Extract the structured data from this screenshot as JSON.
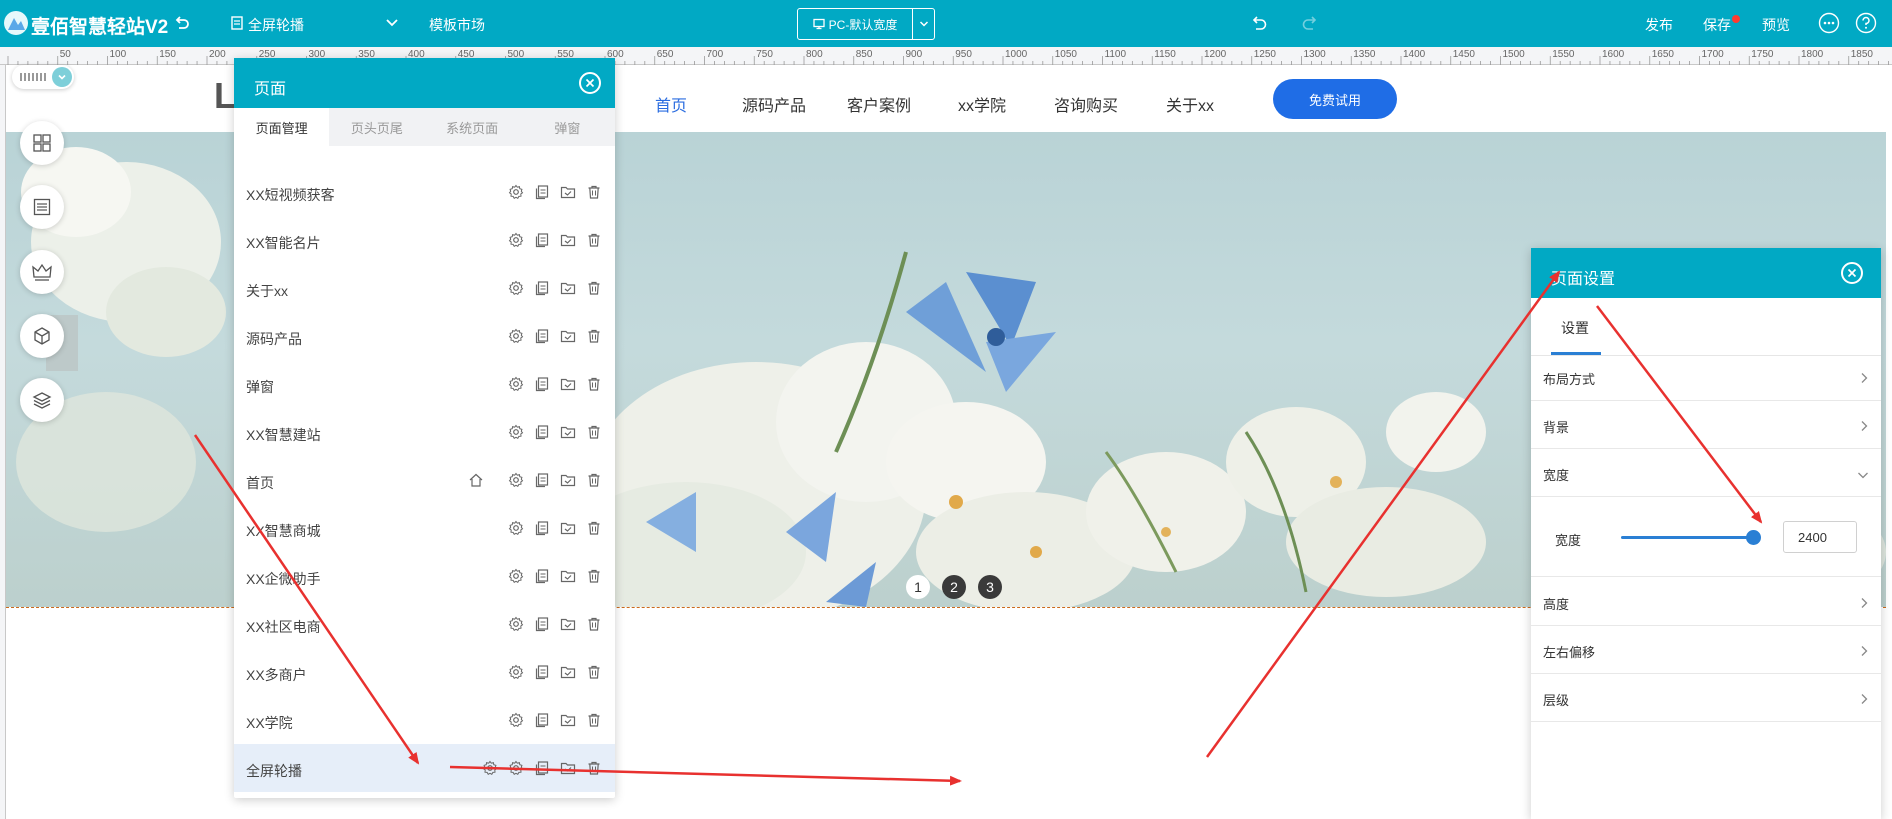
{
  "topbar": {
    "app_title": "壹佰智慧轻站V2",
    "current_page": "全屏轮播",
    "template_market": "模板市场",
    "device_label": "PC-默认宽度",
    "publish": "发布",
    "save": "保存",
    "preview": "预览"
  },
  "ruler": {
    "labels": [
      "50",
      "100",
      "150",
      "200",
      "250",
      "300",
      "350",
      "400",
      "450",
      "500",
      "550",
      "600",
      "650",
      "700",
      "750",
      "800",
      "850",
      "900",
      "950",
      "1000",
      "1050",
      "1100",
      "1150",
      "1200",
      "1250",
      "1300",
      "1350",
      "1400",
      "1450",
      "1500",
      "1550",
      "1600",
      "1650",
      "1700",
      "1750",
      "1800",
      "1850"
    ]
  },
  "site": {
    "logo": "LO",
    "nav": [
      "首页",
      "源码产品",
      "客户案例",
      "xx学院",
      "咨询购买",
      "关于xx"
    ],
    "trial_button": "免费试用",
    "carousel_dots": [
      "1",
      "2",
      "3"
    ]
  },
  "page_panel": {
    "title": "页面",
    "tabs": [
      "页面管理",
      "页头页尾",
      "系统页面",
      "弹窗"
    ],
    "pages": [
      {
        "name": "XX短视频获客"
      },
      {
        "name": "XX智能名片"
      },
      {
        "name": "关于xx"
      },
      {
        "name": "源码产品"
      },
      {
        "name": "弹窗"
      },
      {
        "name": "XX智慧建站"
      },
      {
        "name": "首页"
      },
      {
        "name": "XX智慧商城"
      },
      {
        "name": "XX企微助手"
      },
      {
        "name": "XX社区电商"
      },
      {
        "name": "XX多商户"
      },
      {
        "name": "XX学院"
      },
      {
        "name": "全屏轮播"
      }
    ]
  },
  "settings_panel": {
    "title": "页面设置",
    "tab": "设置",
    "rows": {
      "layout": "布局方式",
      "background": "背景",
      "width": "宽度",
      "height": "高度",
      "offset": "左右偏移",
      "zindex": "层级"
    },
    "width_sub_label": "宽度",
    "width_value": "2400",
    "width_slider_fraction": 0.98
  },
  "colors": {
    "brand": "#01a9c4",
    "accent_blue": "#2b6de0",
    "annotation_red": "#e8312f"
  }
}
